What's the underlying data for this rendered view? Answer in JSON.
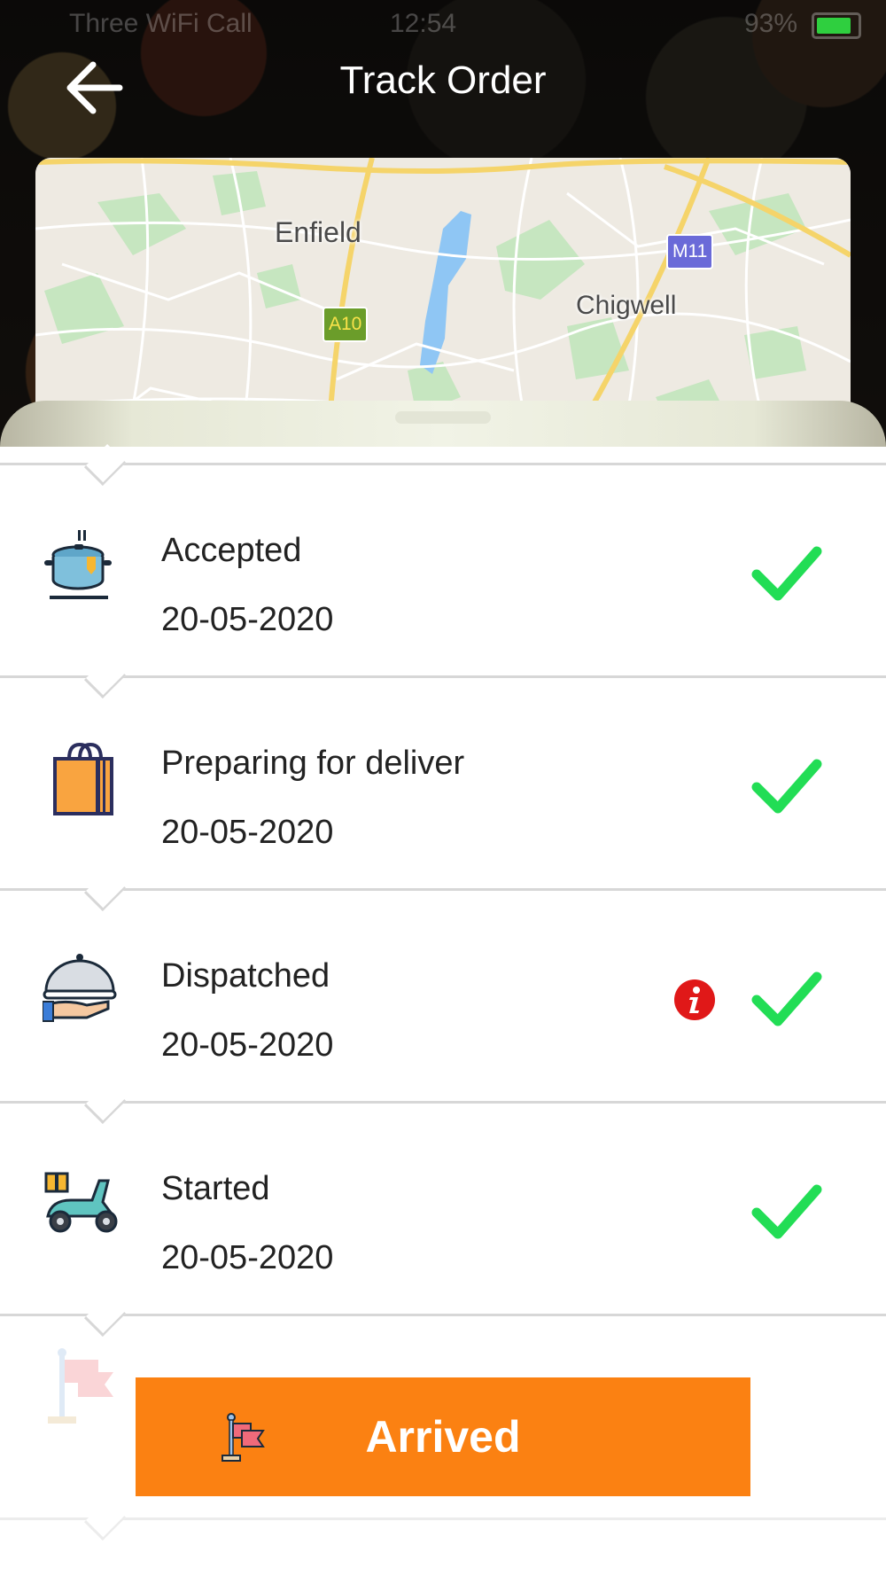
{
  "status_bar": {
    "carrier": "Three WiFi Call",
    "time": "12:54",
    "battery": "93%"
  },
  "header": {
    "title": "Track Order",
    "back_icon": "arrow-left-icon"
  },
  "map": {
    "labels": [
      "Enfield",
      "Chigwell"
    ],
    "road_shields": [
      "A10",
      "M11"
    ],
    "colors": {
      "land": "#eeeae2",
      "park": "#c6e6c0",
      "water": "#8fc6f4",
      "major_road": "#f5d46a"
    }
  },
  "steps": [
    {
      "icon": "cooking-pot-icon",
      "label": "Accepted",
      "date": "20-05-2020",
      "done": true,
      "info": false
    },
    {
      "icon": "shopping-bag-icon",
      "label": "Preparing for deliver",
      "date": "20-05-2020",
      "done": true,
      "info": false
    },
    {
      "icon": "serving-cloche-icon",
      "label": "Dispatched",
      "date": "20-05-2020",
      "done": true,
      "info": true
    },
    {
      "icon": "delivery-scooter-icon",
      "label": "Started",
      "date": "20-05-2020",
      "done": true,
      "info": false
    }
  ],
  "arrived": {
    "label": "Arrived",
    "icon": "flag-icon",
    "color": "#fb8112"
  },
  "colors": {
    "check": "#22dd55",
    "info": "#e01818",
    "divider": "#d7d7d7"
  }
}
